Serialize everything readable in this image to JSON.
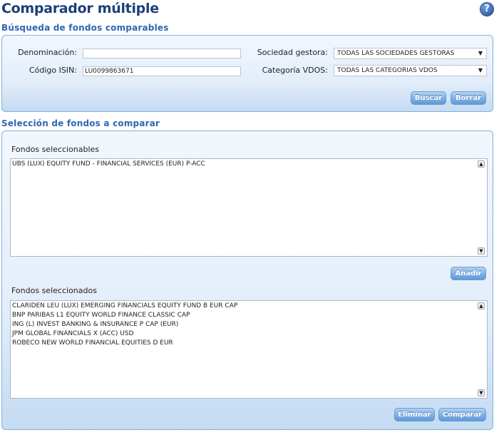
{
  "header": {
    "title": "Comparador múltiple",
    "help_icon": "question-mark-icon",
    "help_glyph": "?"
  },
  "search": {
    "section_title": "Búsqueda de fondos comparables",
    "denominacion_label": "Denominación:",
    "denominacion_value": "",
    "isin_label": "Código ISIN:",
    "isin_value": "LU0099863671",
    "gestora_label": "Sociedad gestora:",
    "gestora_value": "TODAS LAS SOCIEDADES GESTORAS",
    "categoria_label": "Categoría VDOS:",
    "categoria_value": "TODAS LAS CATEGORIAS VDOS",
    "buscar_label": "Buscar",
    "borrar_label": "Borrar"
  },
  "selection": {
    "section_title": "Selección de fondos a comparar",
    "seleccionables_label": "Fondos seleccionables",
    "seleccionables": [
      "UBS (LUX) EQUITY FUND - FINANCIAL SERVICES (EUR) P-ACC"
    ],
    "anadir_label": "Añadir",
    "seleccionados_label": "Fondos seleccionados",
    "seleccionados": [
      "CLARIDEN LEU (LUX) EMERGING FINANCIALS EQUITY FUND B EUR CAP",
      "BNP PARIBAS L1 EQUITY WORLD FINANCE CLASSIC CAP",
      "ING (L) INVEST BANKING & INSURANCE P CAP (EUR)",
      "JPM GLOBAL FINANCIALS X (ACC) USD",
      "ROBECO NEW WORLD FINANCIAL EQUITIES D EUR"
    ],
    "eliminar_label": "Eliminar",
    "comparar_label": "Comparar"
  },
  "colors": {
    "title": "#1d3f78",
    "section_title": "#2e66b3",
    "panel_border": "#86aed9",
    "button": "#7fb1e4"
  }
}
